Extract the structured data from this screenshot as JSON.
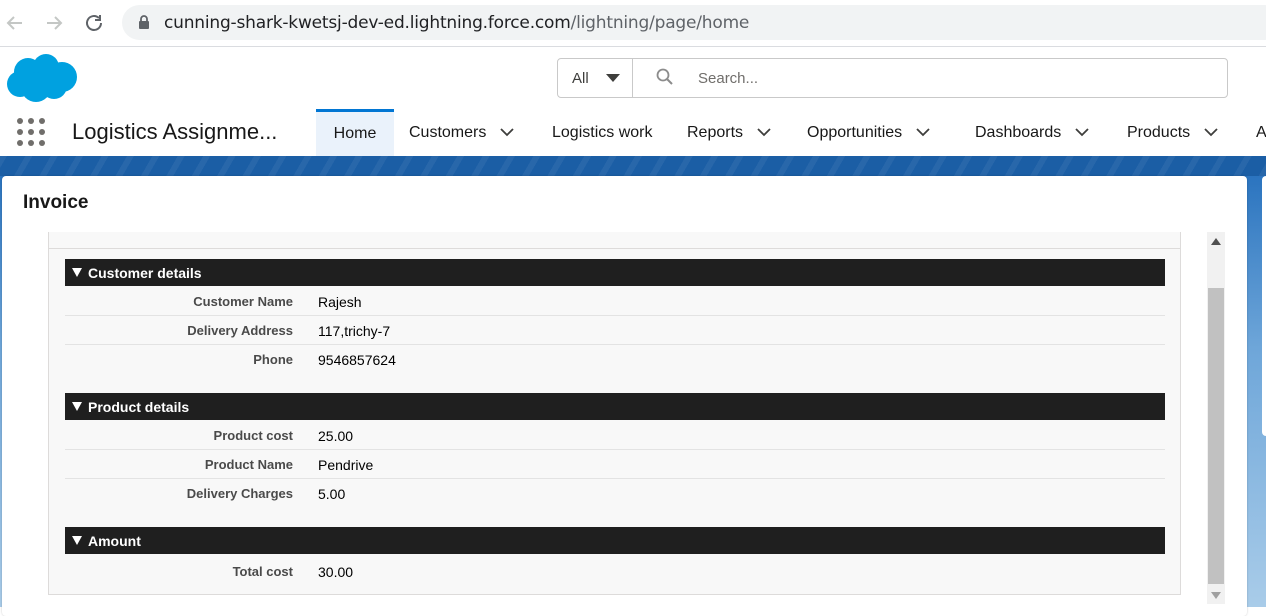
{
  "browser": {
    "url_host": "cunning-shark-kwetsj-dev-ed.lightning.force.com",
    "url_path": "/lightning/page/home",
    "icons": [
      "back-icon",
      "forward-icon",
      "reload-icon",
      "lock-icon"
    ]
  },
  "header": {
    "search_scope": "All",
    "search_placeholder": "Search..."
  },
  "nav": {
    "app_name": "Logistics Assignme...",
    "tabs": [
      {
        "label": "Home",
        "has_menu": false,
        "active": true
      },
      {
        "label": "Customers",
        "has_menu": true
      },
      {
        "label": "Logistics work",
        "has_menu": false
      },
      {
        "label": "Reports",
        "has_menu": true
      },
      {
        "label": "Opportunities",
        "has_menu": true
      },
      {
        "label": "Dashboards",
        "has_menu": true
      },
      {
        "label": "Products",
        "has_menu": true
      },
      {
        "label": "A",
        "has_menu": false
      }
    ]
  },
  "card": {
    "title": "Invoice"
  },
  "invoice": {
    "customer": {
      "title": "Customer details",
      "rows": [
        {
          "label": "Customer Name",
          "value": "Rajesh"
        },
        {
          "label": "Delivery Address",
          "value": "117,trichy-7"
        },
        {
          "label": "Phone",
          "value": "9546857624"
        }
      ]
    },
    "product": {
      "title": "Product details",
      "rows": [
        {
          "label": "Product cost",
          "value": "25.00"
        },
        {
          "label": "Product Name",
          "value": "Pendrive"
        },
        {
          "label": "Delivery Charges",
          "value": "5.00"
        }
      ]
    },
    "amount": {
      "title": "Amount",
      "rows": [
        {
          "label": "Total cost",
          "value": "30.00"
        }
      ]
    }
  },
  "colors": {
    "brand_blue": "#0176d3",
    "banner_blue": "#1b5ea5",
    "section_header_bg": "#1f1f1f"
  }
}
